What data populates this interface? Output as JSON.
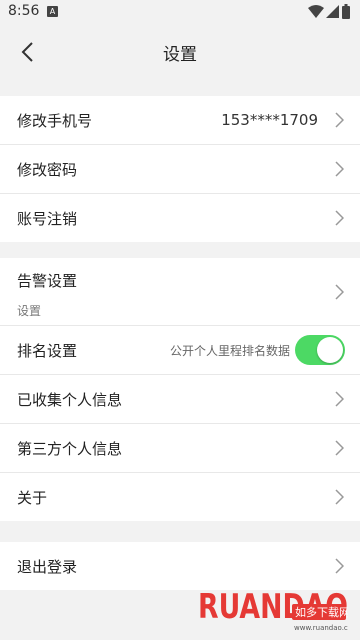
{
  "status_bar": {
    "time": "8:56",
    "notification_icon": "A"
  },
  "header": {
    "title": "设置"
  },
  "group_account": [
    {
      "label": "修改手机号",
      "value": "153****1709"
    },
    {
      "label": "修改密码"
    },
    {
      "label": "账号注销"
    }
  ],
  "group_settings": {
    "alarm": {
      "label": "告警设置",
      "sub": "设置"
    },
    "ranking": {
      "label": "排名设置",
      "toggle_label": "公开个人里程排名数据",
      "toggle_on": true,
      "toggle_color": "#4cd964"
    },
    "collected_info": {
      "label": "已收集个人信息"
    },
    "third_party_info": {
      "label": "第三方个人信息"
    },
    "about": {
      "label": "关于"
    }
  },
  "group_logout": {
    "label": "退出登录"
  },
  "watermark": {
    "brand": "RUANDAO",
    "cn_text": "如多下载网",
    "url": "www.ruandao.com"
  }
}
